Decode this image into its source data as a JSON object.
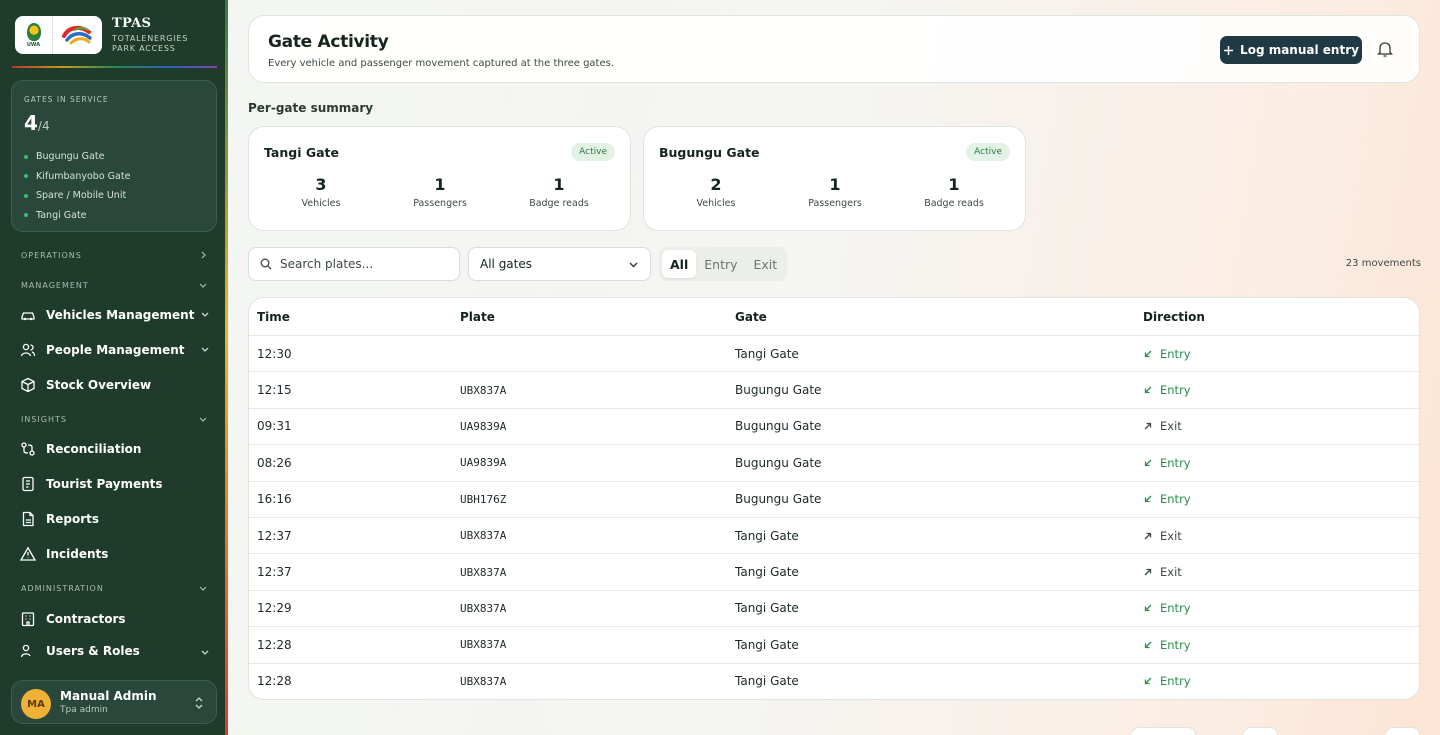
{
  "brand": {
    "title": "TPAS",
    "subtitle": "TOTALENERGIES PARK ACCESS",
    "uwa_text": "UWA"
  },
  "gates_card": {
    "caption": "GATES IN SERVICE",
    "count": "4",
    "total": "/4",
    "gates": [
      "Bugungu Gate",
      "Kifumbanyobo Gate",
      "Spare / Mobile Unit",
      "Tangi Gate"
    ]
  },
  "nav": {
    "sections": {
      "operations": "OPERATIONS",
      "management": "MANAGEMENT",
      "insights": "INSIGHTS",
      "administration": "ADMINISTRATION"
    },
    "items": {
      "vehicles": "Vehicles Management",
      "people": "People Management",
      "stock": "Stock Overview",
      "reconciliation": "Reconciliation",
      "tourist_payments": "Tourist Payments",
      "reports": "Reports",
      "incidents": "Incidents",
      "contractors": "Contractors",
      "users_roles": "Users & Roles"
    }
  },
  "user": {
    "initials": "MA",
    "name": "Manual Admin",
    "role": "Tpa admin"
  },
  "header": {
    "title": "Gate Activity",
    "subtitle": "Every vehicle and passenger movement captured at the three gates.",
    "log_button": "Log manual entry"
  },
  "summary": {
    "label": "Per-gate summary",
    "gates": [
      {
        "name": "Tangi Gate",
        "status": "Active",
        "vehicles": "3",
        "passengers": "1",
        "badge_reads": "1"
      },
      {
        "name": "Bugungu Gate",
        "status": "Active",
        "vehicles": "2",
        "passengers": "1",
        "badge_reads": "1"
      }
    ],
    "labels": {
      "vehicles": "Vehicles",
      "passengers": "Passengers",
      "badge_reads": "Badge reads"
    }
  },
  "filters": {
    "search_placeholder": "Search plates...",
    "gate_select": "All gates",
    "direction_options": [
      "All",
      "Entry",
      "Exit"
    ],
    "direction_selected": "All",
    "movement_count": "23 movements"
  },
  "table": {
    "columns": [
      "Time",
      "Plate",
      "Gate",
      "Direction"
    ],
    "rows": [
      {
        "time": "12:30",
        "plate": "",
        "gate": "Tangi Gate",
        "direction": "Entry"
      },
      {
        "time": "12:15",
        "plate": "UBX837A",
        "gate": "Bugungu Gate",
        "direction": "Entry"
      },
      {
        "time": "09:31",
        "plate": "UA9839A",
        "gate": "Bugungu Gate",
        "direction": "Exit"
      },
      {
        "time": "08:26",
        "plate": "UA9839A",
        "gate": "Bugungu Gate",
        "direction": "Entry"
      },
      {
        "time": "16:16",
        "plate": "UBH176Z",
        "gate": "Bugungu Gate",
        "direction": "Entry"
      },
      {
        "time": "12:37",
        "plate": "UBX837A",
        "gate": "Tangi Gate",
        "direction": "Exit"
      },
      {
        "time": "12:37",
        "plate": "UBX837A",
        "gate": "Tangi Gate",
        "direction": "Exit"
      },
      {
        "time": "12:29",
        "plate": "UBX837A",
        "gate": "Tangi Gate",
        "direction": "Entry"
      },
      {
        "time": "12:28",
        "plate": "UBX837A",
        "gate": "Tangi Gate",
        "direction": "Entry"
      },
      {
        "time": "12:28",
        "plate": "UBX837A",
        "gate": "Tangi Gate",
        "direction": "Entry"
      }
    ]
  },
  "colors": {
    "sidebar": "#1e3b2c",
    "accent_green": "#2c8a4b",
    "primary_button": "#1f3a44",
    "avatar": "#f0b236"
  }
}
